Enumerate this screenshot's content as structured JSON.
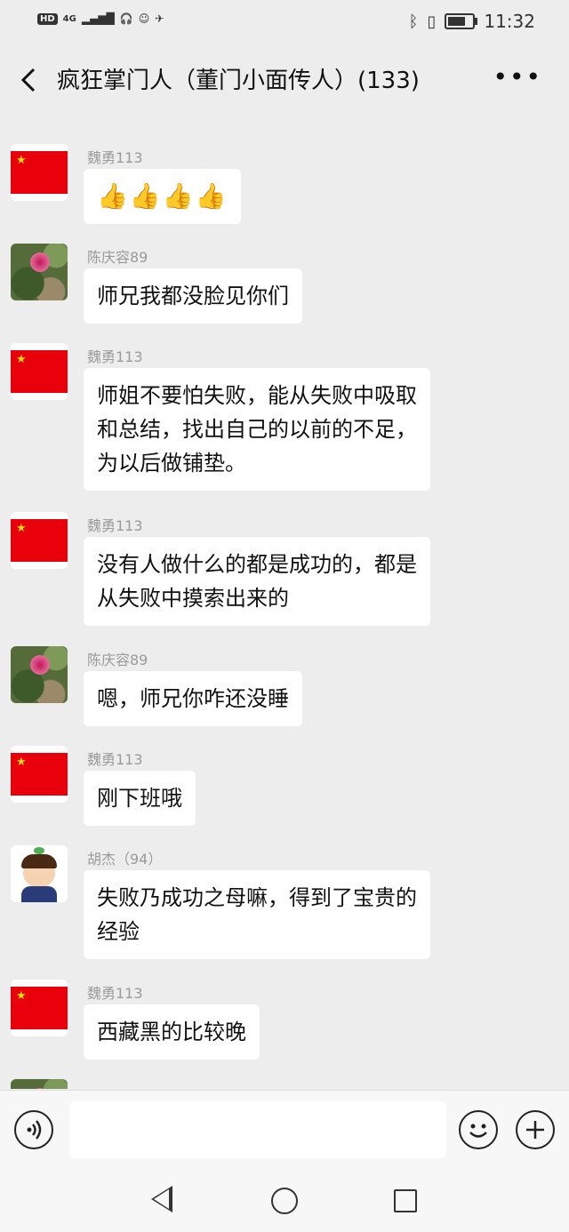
{
  "status_bar": {
    "left_badge": "HD",
    "network": "4G",
    "time": "11:32",
    "battery_level_pct": 70
  },
  "header": {
    "back_icon": "chevron-left-icon",
    "title": "疯狂掌门人（董门小面传人）(133)",
    "more_icon": "more-dots-icon"
  },
  "messages": [
    {
      "sender": "魏勇113",
      "avatar": "china-flag",
      "text": "👍👍👍👍"
    },
    {
      "sender": "陈庆容89",
      "avatar": "rose-photo",
      "text": "师兄我都没脸见你们"
    },
    {
      "sender": "魏勇113",
      "avatar": "china-flag",
      "lines": [
        "师姐不要怕失败，能从失败中吸取",
        "和总结，找出自己的以前的不足，",
        "为以后做铺垫。"
      ]
    },
    {
      "sender": "魏勇113",
      "avatar": "china-flag",
      "lines": [
        "没有人做什么的都是成功的，都是",
        "从失败中摸索出来的"
      ]
    },
    {
      "sender": "陈庆容89",
      "avatar": "rose-photo",
      "text": "嗯，师兄你咋还没睡"
    },
    {
      "sender": "魏勇113",
      "avatar": "china-flag",
      "text": "刚下班哦"
    },
    {
      "sender": "胡杰（94）",
      "avatar": "cartoon-boy",
      "lines": [
        "失败乃成功之母嘛，得到了宝贵的",
        "经验"
      ]
    },
    {
      "sender": "魏勇113",
      "avatar": "china-flag",
      "text": "西藏黑的比较晚"
    }
  ],
  "input_bar": {
    "voice_icon": "voice-icon",
    "input_value": "",
    "emoji_icon": "emoji-icon",
    "plus_icon": "plus-icon"
  },
  "nav_bar": {
    "back": "triangle-back-icon",
    "home": "circle-home-icon",
    "recent": "square-recent-icon"
  }
}
